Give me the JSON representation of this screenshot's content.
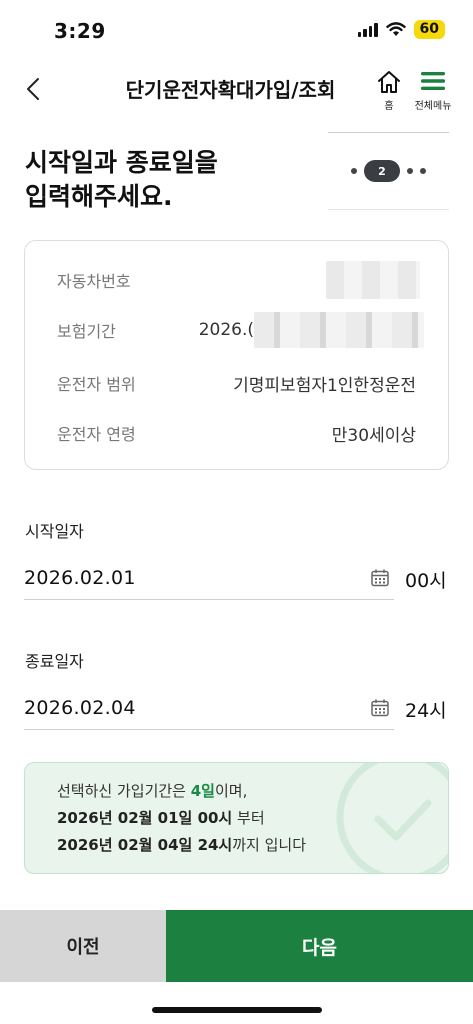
{
  "status_bar": {
    "time": "3:29",
    "battery": "60",
    "icons": [
      "signal-icon",
      "wifi-icon",
      "battery-icon"
    ]
  },
  "header": {
    "title": "단기운전자확대가입/조회",
    "home_label": "홈",
    "menu_label": "전체메뉴"
  },
  "heading": {
    "line1": "시작일과 종료일을",
    "line2": "입력해주세요."
  },
  "step": {
    "current": "2"
  },
  "info": {
    "vehicle_label": "자동차번호",
    "period_label": "보험기간",
    "period_value": "2026.(",
    "scope_label": "운전자 범위",
    "scope_value": "기명피보험자1인한정운전",
    "age_label": "운전자 연령",
    "age_value": "만30세이상"
  },
  "start": {
    "label": "시작일자",
    "date": "2026.02.01",
    "hour": "00시"
  },
  "end": {
    "label": "종료일자",
    "date": "2026.02.04",
    "hour": "24시"
  },
  "summary": {
    "line1_prefix": "선택하신 가입기간은 ",
    "days": "4일",
    "line1_suffix": "이며,",
    "line2_bold": "2026년 02월 01일 00시",
    "line2_suffix": " 부터",
    "line3_bold": "2026년 02월 04일 24시",
    "line3_suffix": "까지 입니다"
  },
  "buttons": {
    "prev": "이전",
    "next": "다음"
  },
  "colors": {
    "primary_green": "#1c8040",
    "highlight_green": "#1a8a44",
    "summary_bg": "#e8f4ec",
    "step_badge": "#3a3d42",
    "battery": "#f5d90a"
  }
}
